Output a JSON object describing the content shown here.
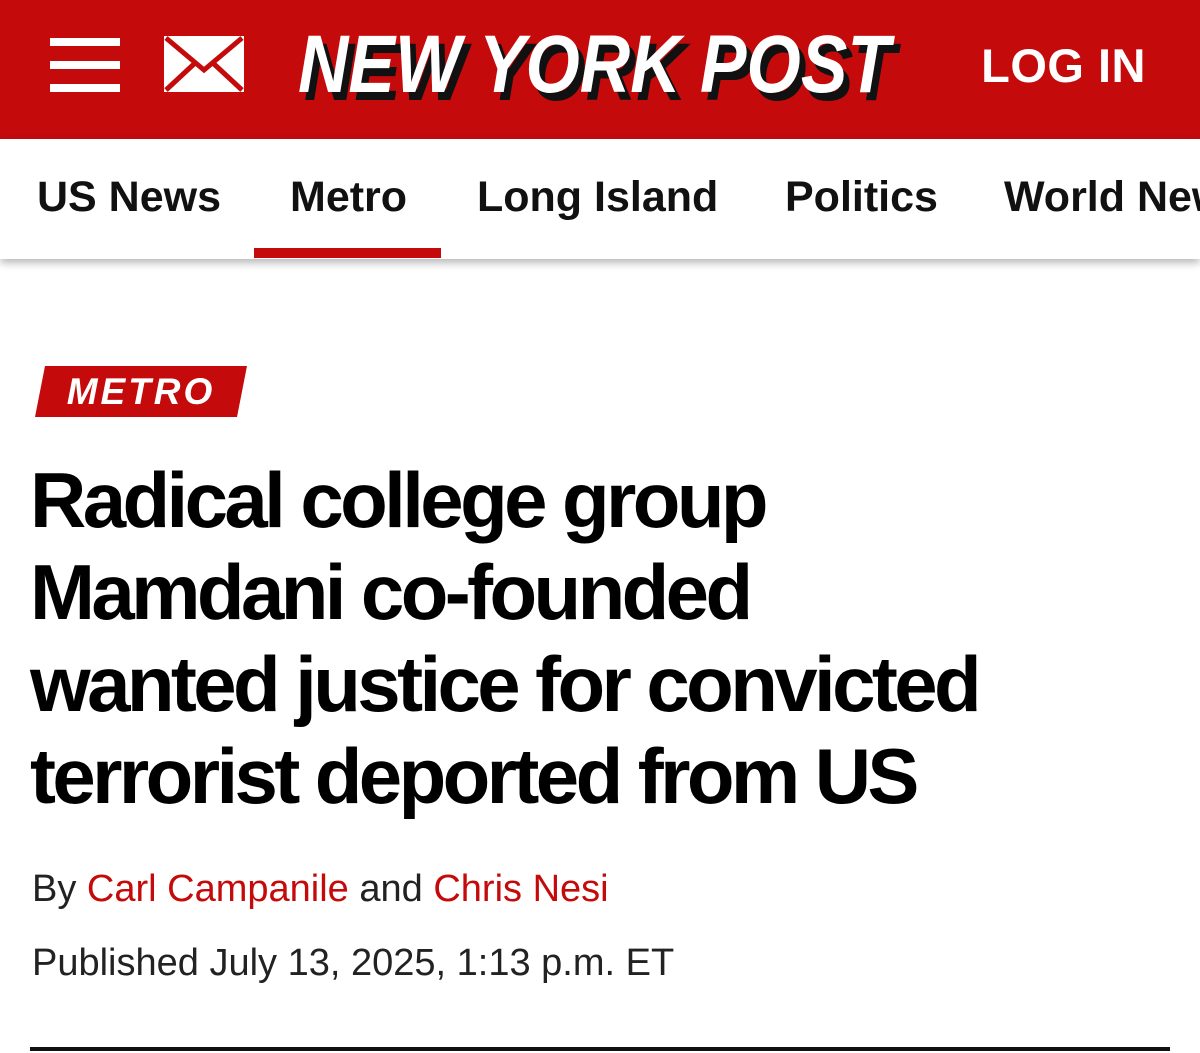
{
  "header": {
    "logo_text": "NEW YORK POST",
    "login_label": "LOG IN",
    "brand_color": "#c40a0a",
    "menu_icon": "hamburger-menu-icon",
    "mail_icon": "envelope-icon"
  },
  "nav": {
    "items": [
      {
        "label": "US News"
      },
      {
        "label": "Metro",
        "active": true
      },
      {
        "label": "Long Island"
      },
      {
        "label": "Politics"
      },
      {
        "label": "World News"
      }
    ]
  },
  "article": {
    "section_tag": "METRO",
    "headline_lines": [
      "Radical college group",
      "Mamdani co-founded",
      "wanted justice for convicted",
      "terrorist deported from US"
    ],
    "byline_prefix": "By",
    "authors": [
      "Carl Campanile",
      "Chris Nesi"
    ],
    "byline_conjunction": "and",
    "published": "Published July 13, 2025, 1:13 p.m. ET"
  }
}
